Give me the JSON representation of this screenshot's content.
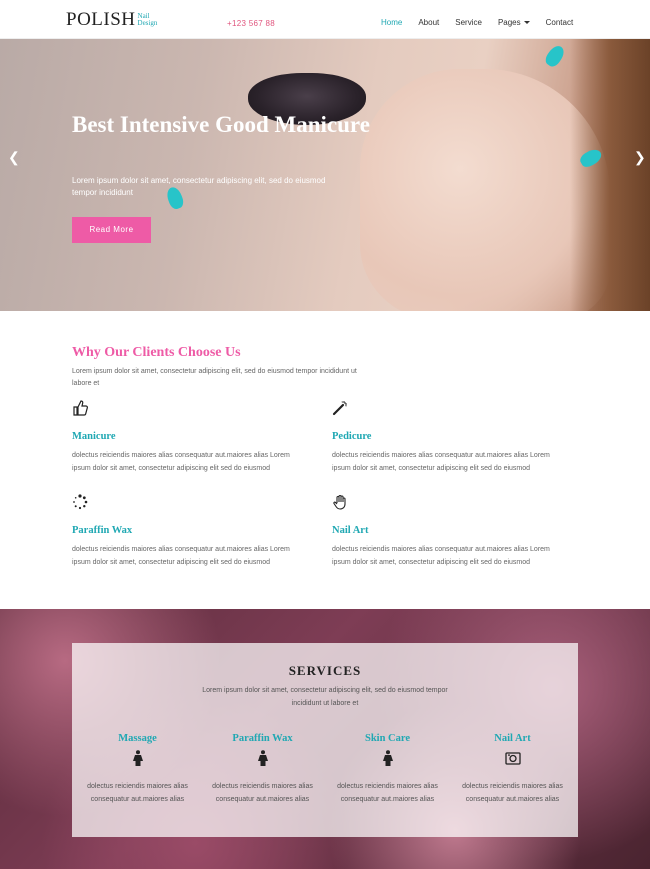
{
  "header": {
    "logo": "POLISH",
    "logo_sub": "Nail Design",
    "phone": "+123 567 88",
    "nav": [
      "Home",
      "About",
      "Service",
      "Pages",
      "Contact"
    ]
  },
  "hero": {
    "title": "Best Intensive Good Manicure",
    "text": "Lorem ipsum dolor sit amet, consectetur adipiscing elit, sed do eiusmod tempor incididunt",
    "button": "Read More"
  },
  "why": {
    "title": "Why Our Clients Choose Us",
    "intro": "Lorem ipsum dolor sit amet, consectetur adipiscing elit, sed do eiusmod tempor incididunt ut labore et",
    "features": [
      {
        "icon": "thumbs-up-icon",
        "title": "Manicure",
        "desc": "dolectus reiciendis maiores alias consequatur aut.maiores alias Lorem ipsum dolor sit amet, consectetur adipiscing elit sed do eiusmod"
      },
      {
        "icon": "magic-wand-icon",
        "title": "Pedicure",
        "desc": "dolectus reiciendis maiores alias consequatur aut.maiores alias Lorem ipsum dolor sit amet, consectetur adipiscing elit sed do eiusmod"
      },
      {
        "icon": "spinner-icon",
        "title": "Paraffin Wax",
        "desc": "dolectus reiciendis maiores alias consequatur aut.maiores alias Lorem ipsum dolor sit amet, consectetur adipiscing elit sed do eiusmod"
      },
      {
        "icon": "hand-icon",
        "title": "Nail Art",
        "desc": "dolectus reiciendis maiores alias consequatur aut.maiores alias Lorem ipsum dolor sit amet, consectetur adipiscing elit sed do eiusmod"
      }
    ]
  },
  "services": {
    "title": "SERVICES",
    "intro": "Lorem ipsum dolor sit amet, consectetur adipiscing elit, sed do eiusmod tempor incididunt ut labore et",
    "items": [
      {
        "icon": "female-icon",
        "title": "Massage",
        "desc": "dolectus reiciendis maiores alias consequatur aut.maiores alias"
      },
      {
        "icon": "female-icon",
        "title": "Paraffin Wax",
        "desc": "dolectus reiciendis maiores alias consequatur aut.maiores alias"
      },
      {
        "icon": "female-icon",
        "title": "Skin Care",
        "desc": "dolectus reiciendis maiores alias consequatur aut.maiores alias"
      },
      {
        "icon": "camera-icon",
        "title": "Nail Art",
        "desc": "dolectus reiciendis maiores alias consequatur aut.maiores alias"
      }
    ]
  },
  "colors": {
    "accent_teal": "#20a8b3",
    "accent_pink": "#ee5ba6"
  }
}
